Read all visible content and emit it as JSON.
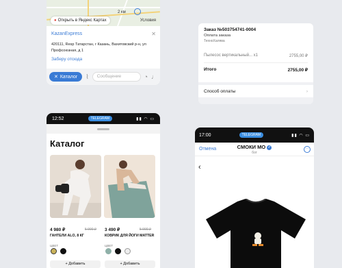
{
  "chat": {
    "map_link": "Открыть в Яндекс Картах",
    "map_scale": "2 км",
    "map_terms": "Условия",
    "store_name": "KazanExpress",
    "address": "420111, Resp Татарстан, г Казань, Вахитовский р-н, ул Профсоюзная, д 1",
    "pickup_label": "Заберу отсюда",
    "catalog_button": "Каталог",
    "message_placeholder": "Сообщение",
    "icons": [
      "paperclip-icon",
      "sticker-icon",
      "mic-icon",
      "map-pin-icon",
      "close-icon"
    ]
  },
  "order": {
    "title": "Заказ №503754741-0004",
    "subtitle": "Оплата заказа",
    "shop": "ТехноХалява",
    "item_name": "Пылесос вертикальный... x1",
    "item_price": "2755,00 ₽",
    "total_label": "Итого",
    "total_value": "2755,00 ₽",
    "payment_label": "Способ оплаты"
  },
  "catalog": {
    "time": "12:52",
    "badge": "TELEGRAM",
    "title": "Каталог",
    "products": [
      {
        "price": "4 980 ₽",
        "old_price": "5 990 ₽",
        "name": "ГАНТЕЛИ ALO, 8 КГ",
        "color_label": "ЦВЕТ",
        "add_label": "+ Добавить",
        "colors": [
          "#c9b25a",
          "#111111"
        ]
      },
      {
        "price": "3 490 ₽",
        "old_price": "5 990 ₽",
        "name": "КОВРИК ДЛЯ ЙОГИ MATTER",
        "color_label": "ЦВЕТ",
        "add_label": "+ Добавить",
        "colors": [
          "#8fb0a8",
          "#111111",
          "#eeeeee"
        ]
      }
    ]
  },
  "bot": {
    "time": "17:00",
    "badge": "TELEGRAM",
    "cancel": "Отмена",
    "name": "СМОКИ МО",
    "subtitle": "бот"
  }
}
